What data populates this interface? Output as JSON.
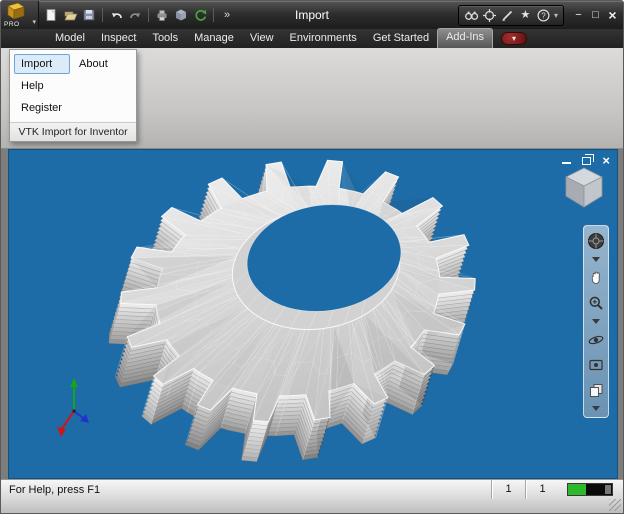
{
  "app": {
    "edition": "PRO"
  },
  "titlebar": {
    "title": "Import"
  },
  "tabs": {
    "items": [
      {
        "label": "Model"
      },
      {
        "label": "Inspect"
      },
      {
        "label": "Tools"
      },
      {
        "label": "Manage"
      },
      {
        "label": "View"
      },
      {
        "label": "Environments"
      },
      {
        "label": "Get Started"
      },
      {
        "label": "Add-Ins"
      }
    ],
    "active_label": "Add-Ins"
  },
  "flyout": {
    "items": [
      {
        "label": "Import",
        "highlighted": true
      },
      {
        "label": "About",
        "highlighted": false
      },
      {
        "label": "Help",
        "highlighted": false
      },
      {
        "label": "Register",
        "highlighted": false
      }
    ],
    "panel_title": "VTK Import for Inventor"
  },
  "statusbar": {
    "help_text": "For Help, press F1",
    "counter_a": "1",
    "counter_b": "1"
  },
  "icons": {
    "qat": [
      "new-file",
      "open",
      "save",
      "undo",
      "redo",
      "print",
      "update",
      "refresh",
      "expand"
    ],
    "titlebar_tools": [
      "search-binoculars",
      "select-crosshair",
      "pen",
      "favorites-star",
      "help"
    ],
    "window_controls": [
      "minimize",
      "maximize",
      "close"
    ],
    "document_controls": [
      "minimize",
      "restore",
      "close"
    ],
    "navigation_bar": [
      "navigation-wheel",
      "pan-hand",
      "zoom",
      "orbit",
      "look-at",
      "previous-view"
    ]
  },
  "colors": {
    "viewport_blue": "#1d6ca7",
    "progress_green": "#2eb82e",
    "highlight_blue_border": "#6ea6d8",
    "highlight_blue_fill": "#dcebf8"
  }
}
